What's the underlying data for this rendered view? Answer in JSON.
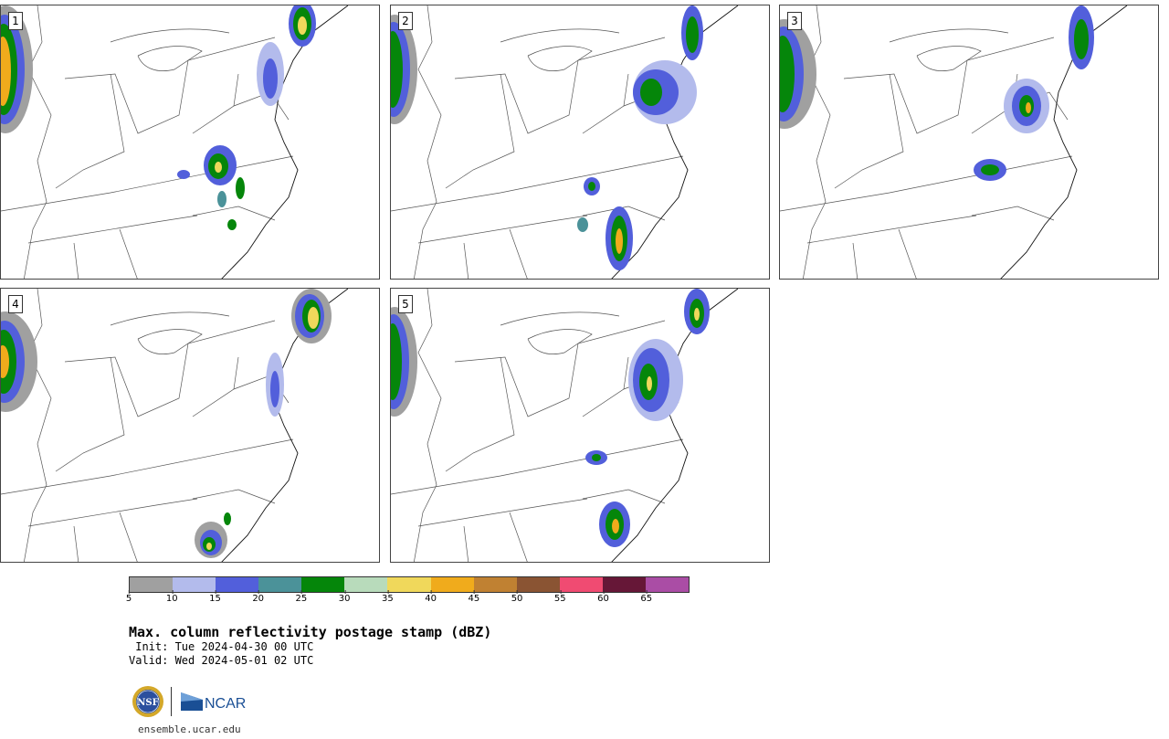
{
  "panels": [
    {
      "label": "1"
    },
    {
      "label": "2"
    },
    {
      "label": "3"
    },
    {
      "label": "4"
    },
    {
      "label": "5"
    }
  ],
  "colorbar": {
    "ticks": [
      "5",
      "10",
      "15",
      "20",
      "25",
      "30",
      "35",
      "40",
      "45",
      "50",
      "55",
      "60",
      "65"
    ],
    "colors": [
      "#a0a0a0",
      "#b3bbec",
      "#525fdb",
      "#4b9299",
      "#05860a",
      "#b8dbbb",
      "#f0d85b",
      "#f0ab1c",
      "#c08132",
      "#8a5433",
      "#f04b72",
      "#661737",
      "#aa4da5"
    ]
  },
  "title": "Max. column reflectivity postage stamp (dBZ)",
  "init": " Init: Tue 2024-04-30 00 UTC",
  "valid": "Valid: Wed 2024-05-01 02 UTC",
  "logos": {
    "nsf_text": "NSF",
    "ncar_text": "NCAR"
  },
  "site": "ensemble.ucar.edu"
}
